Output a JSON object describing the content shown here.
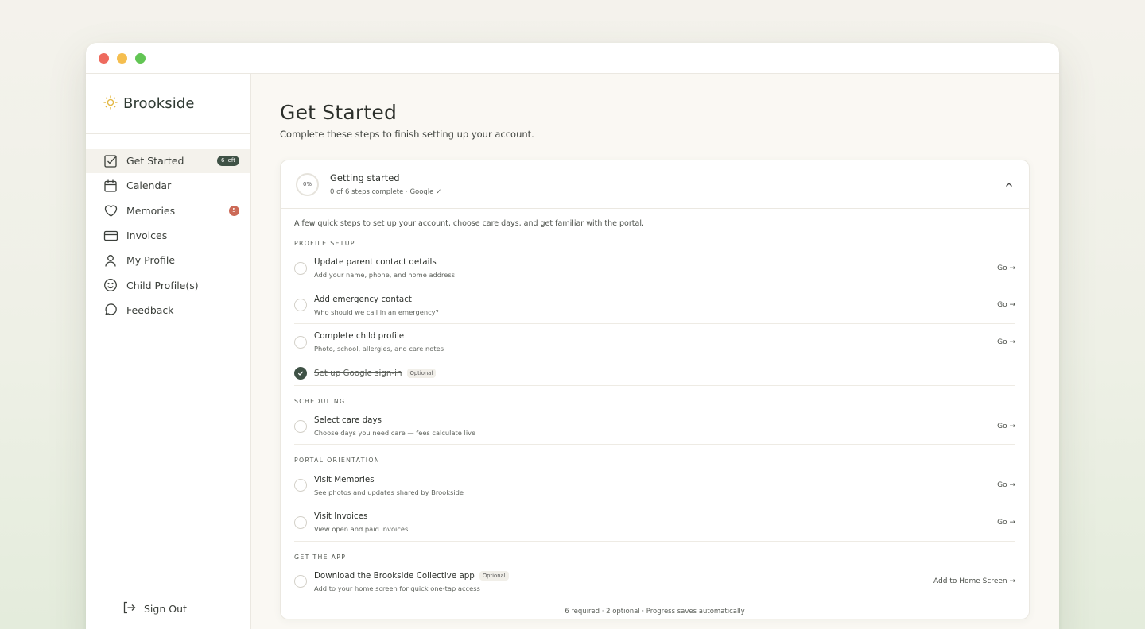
{
  "app": {
    "name": "Brookside"
  },
  "sidebar": {
    "items": [
      {
        "label": "Get Started",
        "badge": "6 left",
        "icon": "checklist-icon",
        "active": true
      },
      {
        "label": "Calendar",
        "icon": "calendar-icon"
      },
      {
        "label": "Memories",
        "badge": "5",
        "icon": "heart-icon"
      },
      {
        "label": "Invoices",
        "icon": "credit-card-icon"
      },
      {
        "label": "My Profile",
        "icon": "person-icon"
      },
      {
        "label": "Child Profile(s)",
        "icon": "smiley-icon"
      },
      {
        "label": "Feedback",
        "icon": "chat-bubble-icon"
      }
    ],
    "sign_out": "Sign Out"
  },
  "page": {
    "title": "Get Started",
    "subtitle": "Complete these steps to finish setting up your account."
  },
  "card": {
    "progress": "0%",
    "title": "Getting started",
    "meta": "0 of 6 steps complete · Google ✓",
    "intro": "A few quick steps to set up your account, choose care days, and get familiar with the portal.",
    "sections": {
      "profile": "PROFILE SETUP",
      "scheduling": "SCHEDULING",
      "orientation": "PORTAL ORIENTATION",
      "app": "GET THE APP"
    },
    "tasks": [
      {
        "title": "Update parent contact details",
        "sub": "Add your name, phone, and home address",
        "action": "Go →"
      },
      {
        "title": "Add emergency contact",
        "sub": "Who should we call in an emergency?",
        "action": "Go →"
      },
      {
        "title": "Complete child profile",
        "sub": "Photo, school, allergies, and care notes",
        "action": "Go →"
      },
      {
        "title": "Set up Google sign-in",
        "tag": "Optional",
        "done": true
      },
      {
        "title": "Select care days",
        "sub": "Choose days you need care — fees calculate live",
        "action": "Go →"
      },
      {
        "title": "Visit Memories",
        "sub": "See photos and updates shared by Brookside",
        "action": "Go →"
      },
      {
        "title": "Visit Invoices",
        "sub": "View open and paid invoices",
        "action": "Go →"
      },
      {
        "title": "Download the Brookside Collective app",
        "tag": "Optional",
        "sub": "Add to your home screen for quick one-tap access",
        "action": "Add to Home Screen →"
      }
    ],
    "footer": "6 required · 2 optional · Progress saves automatically"
  },
  "colors": {
    "accent": "#3f5246",
    "badge_red": "#cc6a57",
    "sun": "#e3b844"
  }
}
